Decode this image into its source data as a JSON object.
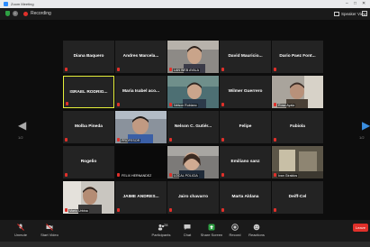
{
  "window": {
    "title": "Zoom Meeting",
    "minimize": "–",
    "maximize": "□",
    "close": "✕"
  },
  "topbar": {
    "recording_label": "Recording",
    "info_glyph": "i",
    "view_label": "Speaker View"
  },
  "nav": {
    "prev": "◀",
    "next": "▶",
    "page_left": "1/2",
    "page_right": "1/2"
  },
  "tiles": [
    {
      "name": "Diana Baquero",
      "type": "name"
    },
    {
      "name": "Andres  Marcela...",
      "type": "name"
    },
    {
      "name": "",
      "label": "LAN WEB AYALA",
      "type": "video"
    },
    {
      "name": "David  Mauricio...",
      "type": "name"
    },
    {
      "name": "Dario Paez Font...",
      "type": "name"
    },
    {
      "name": "ISRAEL RODRIG...",
      "type": "name",
      "active": true
    },
    {
      "name": "Maria Isabel aco...",
      "type": "name"
    },
    {
      "name": "",
      "label": "Nelson Rubiano",
      "type": "video"
    },
    {
      "name": "Wilmer Guerrero",
      "type": "name"
    },
    {
      "name": "",
      "label": "Rosa Ayala",
      "type": "video"
    },
    {
      "name": "Molba Pineda",
      "type": "name"
    },
    {
      "name": "",
      "label": "PROFESOR",
      "type": "video"
    },
    {
      "name": "Nelson C. Gutiér...",
      "type": "name"
    },
    {
      "name": "Felipe",
      "type": "name"
    },
    {
      "name": "Fabiola",
      "type": "name"
    },
    {
      "name": "Rogelio",
      "type": "name"
    },
    {
      "name": "",
      "label": "FELIX HERNANDEZ",
      "type": "dark"
    },
    {
      "name": "",
      "label": "LOCAL POLICIA",
      "type": "video"
    },
    {
      "name": "Emiliano sanz",
      "type": "name"
    },
    {
      "name": "",
      "label": "Ivan Giraldos",
      "type": "video"
    },
    {
      "name": "",
      "label": "Mario Urbina",
      "type": "video"
    },
    {
      "name": "JAIME ANDRES...",
      "type": "name"
    },
    {
      "name": "Jairo chavarro",
      "type": "name"
    },
    {
      "name": "Marta Aldana",
      "type": "name"
    },
    {
      "name": "Deiff-Cel",
      "type": "name"
    }
  ],
  "toolbar": {
    "unmute": "Unmute",
    "start_video": "Start Video",
    "participants": "Participants",
    "participants_count": "28",
    "chat": "Chat",
    "share_screen": "Share Screen",
    "record": "Record",
    "reactions": "Reactions",
    "end": "Leave"
  },
  "colors": {
    "share_green": "#2ea043",
    "end_red": "#e0302a",
    "active_border": "#e6f03a",
    "accent_blue": "#3a8dde"
  }
}
